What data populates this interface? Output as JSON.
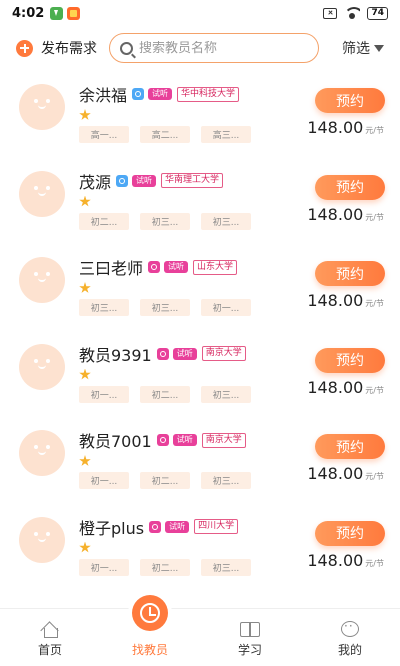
{
  "status_bar": {
    "time": "4:02",
    "battery": "74"
  },
  "top_bar": {
    "publish_label": "发布需求",
    "search_placeholder": "搜索教员名称",
    "filter_label": "筛选"
  },
  "teachers": [
    {
      "name": "余洪福",
      "gender": "male",
      "trial": "试听",
      "school": "华中科技大学",
      "grades": [
        "高一...",
        "高二...",
        "高三..."
      ],
      "book_label": "预约",
      "price": "148.00",
      "unit": "元/节"
    },
    {
      "name": "茂源",
      "gender": "male",
      "trial": "试听",
      "school": "华南理工大学",
      "grades": [
        "初二...",
        "初三...",
        "初三..."
      ],
      "book_label": "预约",
      "price": "148.00",
      "unit": "元/节"
    },
    {
      "name": "三曰老师",
      "gender": "female",
      "trial": "试听",
      "school": "山东大学",
      "grades": [
        "初三...",
        "初三...",
        "初一..."
      ],
      "book_label": "预约",
      "price": "148.00",
      "unit": "元/节"
    },
    {
      "name": "教员9391",
      "gender": "female",
      "trial": "试听",
      "school": "南京大学",
      "grades": [
        "初一...",
        "初二...",
        "初三..."
      ],
      "book_label": "预约",
      "price": "148.00",
      "unit": "元/节"
    },
    {
      "name": "教员7001",
      "gender": "female",
      "trial": "试听",
      "school": "南京大学",
      "grades": [
        "初一...",
        "初二...",
        "初三..."
      ],
      "book_label": "预约",
      "price": "148.00",
      "unit": "元/节"
    },
    {
      "name": "橙子plus",
      "gender": "female",
      "trial": "试听",
      "school": "四川大学",
      "grades": [
        "初一...",
        "初二...",
        "初三..."
      ],
      "book_label": "预约",
      "price": "148.00",
      "unit": "元/节"
    }
  ],
  "bottom_nav": [
    {
      "label": "首页",
      "icon": "home-icon",
      "active": false
    },
    {
      "label": "找教员",
      "icon": "clock-icon",
      "active": true
    },
    {
      "label": "学习",
      "icon": "book-icon",
      "active": false
    },
    {
      "label": "我的",
      "icon": "chat-icon",
      "active": false
    }
  ],
  "colors": {
    "accent": "#ff7a3d",
    "badge_pink": "#e8409a",
    "school_red": "#d6225c",
    "tag_bg": "#fdeee3",
    "star": "#f6b12c"
  }
}
